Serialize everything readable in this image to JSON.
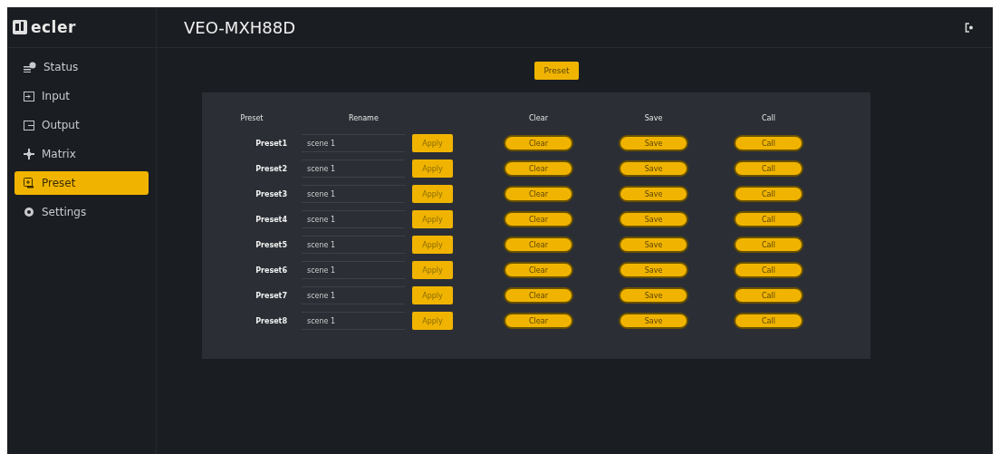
{
  "logo": {
    "text": "ecler"
  },
  "header": {
    "title": "VEO-MXH88D"
  },
  "sidebar": {
    "items": [
      {
        "label": "Status",
        "kind": "status",
        "selected": false
      },
      {
        "label": "Input",
        "kind": "input",
        "selected": false
      },
      {
        "label": "Output",
        "kind": "output",
        "selected": false
      },
      {
        "label": "Matrix",
        "kind": "matrix",
        "selected": false
      },
      {
        "label": "Preset",
        "kind": "preset",
        "selected": true
      },
      {
        "label": "Settings",
        "kind": "settings",
        "selected": false
      }
    ]
  },
  "tab": {
    "label": "Preset"
  },
  "table": {
    "columns": [
      "Preset",
      "Rename",
      "Clear",
      "Save",
      "Call"
    ],
    "rows": [
      {
        "name": "Preset1",
        "value": "scene 1",
        "apply": "Apply",
        "clear": "Clear",
        "save": "Save",
        "call": "Call"
      },
      {
        "name": "Preset2",
        "value": "scene 1",
        "apply": "Apply",
        "clear": "Clear",
        "save": "Save",
        "call": "Call"
      },
      {
        "name": "Preset3",
        "value": "scene 1",
        "apply": "Apply",
        "clear": "Clear",
        "save": "Save",
        "call": "Call"
      },
      {
        "name": "Preset4",
        "value": "scene 1",
        "apply": "Apply",
        "clear": "Clear",
        "save": "Save",
        "call": "Call"
      },
      {
        "name": "Preset5",
        "value": "scene 1",
        "apply": "Apply",
        "clear": "Clear",
        "save": "Save",
        "call": "Call"
      },
      {
        "name": "Preset6",
        "value": "scene 1",
        "apply": "Apply",
        "clear": "Clear",
        "save": "Save",
        "call": "Call"
      },
      {
        "name": "Preset7",
        "value": "scene 1",
        "apply": "Apply",
        "clear": "Clear",
        "save": "Save",
        "call": "Call"
      },
      {
        "name": "Preset8",
        "value": "scene 1",
        "apply": "Apply",
        "clear": "Clear",
        "save": "Save",
        "call": "Call"
      }
    ]
  }
}
